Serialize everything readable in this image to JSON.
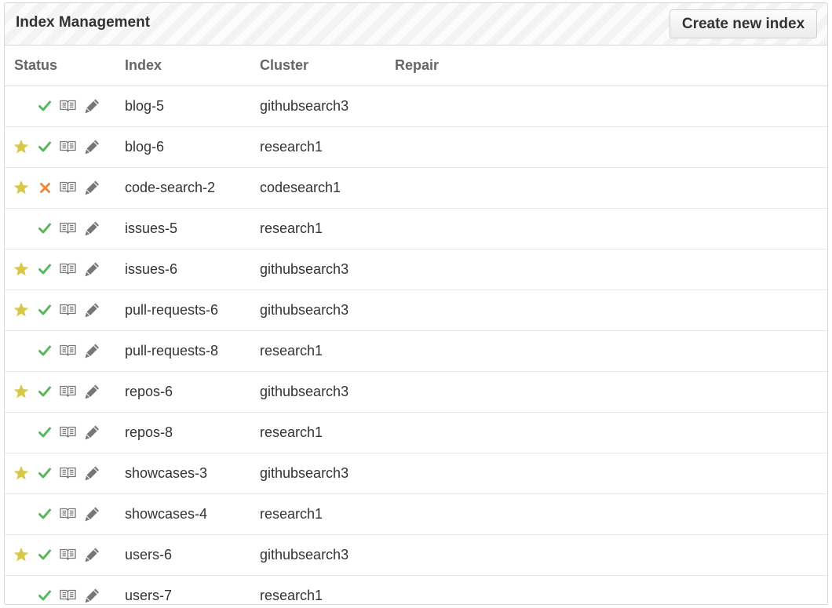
{
  "panel": {
    "title": "Index Management",
    "create_label": "Create new index"
  },
  "columns": {
    "status": "Status",
    "index": "Index",
    "cluster": "Cluster",
    "repair": "Repair"
  },
  "colors": {
    "star": "#d8c84a",
    "ok": "#5cb85c",
    "error": "#f0883e",
    "icon_gray": "#777777"
  },
  "rows": [
    {
      "starred": false,
      "status": "ok",
      "index": "blog-5",
      "cluster": "githubsearch3",
      "repair": ""
    },
    {
      "starred": true,
      "status": "ok",
      "index": "blog-6",
      "cluster": "research1",
      "repair": ""
    },
    {
      "starred": true,
      "status": "error",
      "index": "code-search-2",
      "cluster": "codesearch1",
      "repair": ""
    },
    {
      "starred": false,
      "status": "ok",
      "index": "issues-5",
      "cluster": "research1",
      "repair": ""
    },
    {
      "starred": true,
      "status": "ok",
      "index": "issues-6",
      "cluster": "githubsearch3",
      "repair": ""
    },
    {
      "starred": true,
      "status": "ok",
      "index": "pull-requests-6",
      "cluster": "githubsearch3",
      "repair": ""
    },
    {
      "starred": false,
      "status": "ok",
      "index": "pull-requests-8",
      "cluster": "research1",
      "repair": ""
    },
    {
      "starred": true,
      "status": "ok",
      "index": "repos-6",
      "cluster": "githubsearch3",
      "repair": ""
    },
    {
      "starred": false,
      "status": "ok",
      "index": "repos-8",
      "cluster": "research1",
      "repair": ""
    },
    {
      "starred": true,
      "status": "ok",
      "index": "showcases-3",
      "cluster": "githubsearch3",
      "repair": ""
    },
    {
      "starred": false,
      "status": "ok",
      "index": "showcases-4",
      "cluster": "research1",
      "repair": ""
    },
    {
      "starred": true,
      "status": "ok",
      "index": "users-6",
      "cluster": "githubsearch3",
      "repair": ""
    },
    {
      "starred": false,
      "status": "ok",
      "index": "users-7",
      "cluster": "research1",
      "repair": ""
    }
  ]
}
